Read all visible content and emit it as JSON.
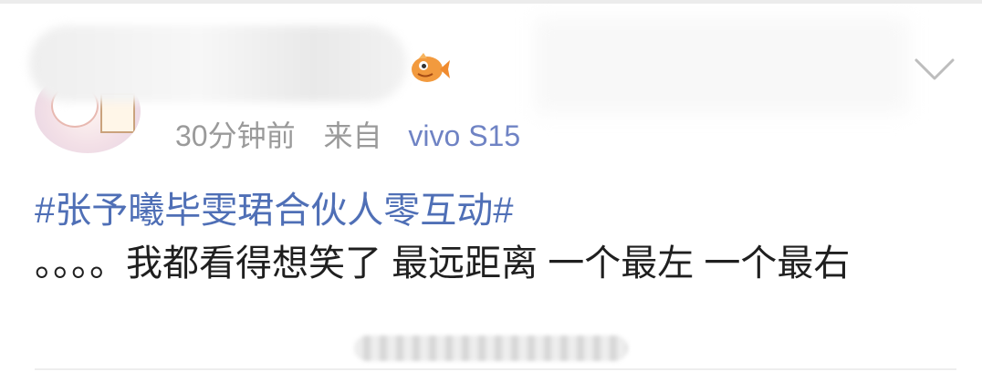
{
  "post": {
    "time": "30分钟前",
    "source_prefix": "来自",
    "source_device": "vivo S15",
    "topic": "#张予曦毕雯珺合伙人零互动#",
    "text": "。。。。我都看得想笑了 最远距离 一个最左 一个最右"
  },
  "icons": {
    "badge": "fish-badge-icon",
    "menu": "chevron-down-icon"
  },
  "colors": {
    "link": "#4f6fb6",
    "device": "#6f83c4",
    "meta": "#9a9a9a",
    "text": "#1f1f1f"
  }
}
